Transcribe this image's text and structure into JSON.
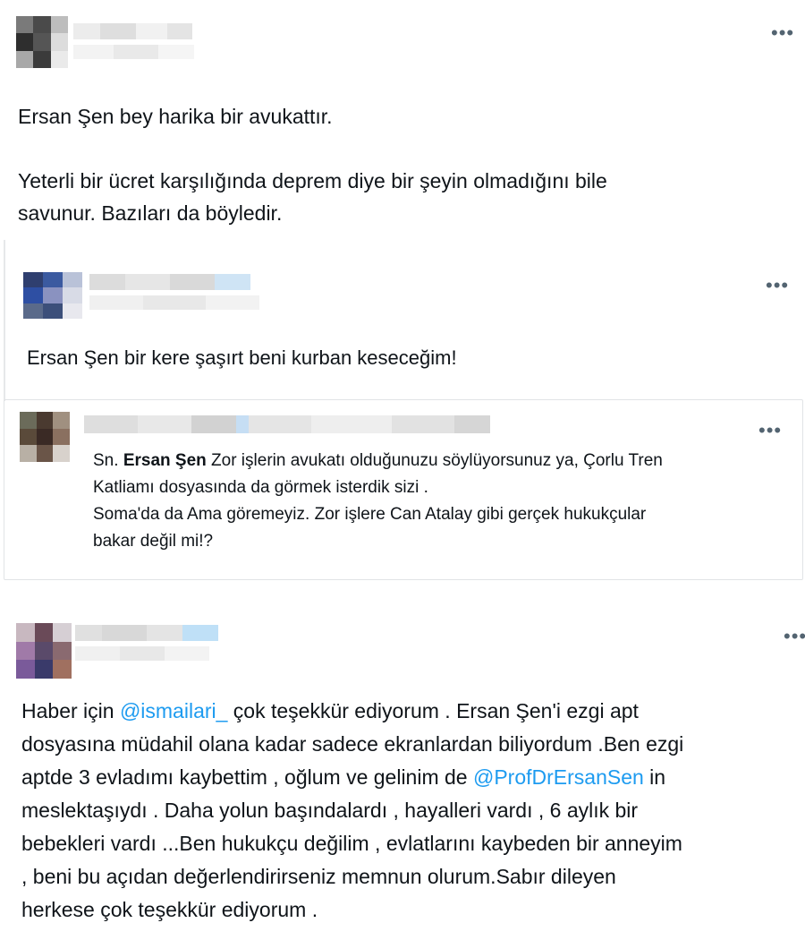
{
  "tweet1": {
    "more_icon": "more-horizontal-icon",
    "text": "Ersan Şen bey harika bir avukattır.\n\nYeterli bir ücret karşılığında deprem diye bir şeyin olmadığını bile\nsavunur. Bazıları da böyledir."
  },
  "tweet2": {
    "more_icon": "more-horizontal-icon",
    "text": "Ersan Şen bir kere şaşırt beni kurban keseceğim!"
  },
  "tweet3": {
    "more_icon": "more-horizontal-icon",
    "prefix": "Sn. ",
    "name_bold": "Ersan Şen",
    "text": " Zor işlerin avukatı olduğunuzu söylüyorsunuz ya, Çorlu Tren\nKatliamı dosyasında da görmek isterdik sizi .\nSoma'da da Ama göremeyiz. Zor işlere Can Atalay gibi gerçek hukukçular\nbakar değil mi!?"
  },
  "tweet4": {
    "more_icon": "more-horizontal-icon",
    "part1": "Haber için ",
    "mention1": "@ismailari_",
    "part2": " çok teşekkür ediyorum . Ersan Şen'i ezgi apt\ndosyasına müdahil olana kadar sadece ekranlardan biliyordum .Ben ezgi\naptde 3 evladımı kaybettim , oğlum ve gelinim de ",
    "mention2": "@ProfDrErsanSen",
    "part3": " in\nmeslektaşıydı . Daha yolun başındalardı , hayalleri vardı , 6 aylık bir\nbebekleri vardı ...Ben hukukçu değilim , evlatlarını kaybeden bir anneyim\n, beni bu açıdan değerlendirirseniz memnun olurum.Sabır dileyen\nherkese çok teşekkür ediyorum ."
  },
  "colors": {
    "text": "#0f1419",
    "link": "#1d9bf0",
    "secondary": "#536471"
  }
}
